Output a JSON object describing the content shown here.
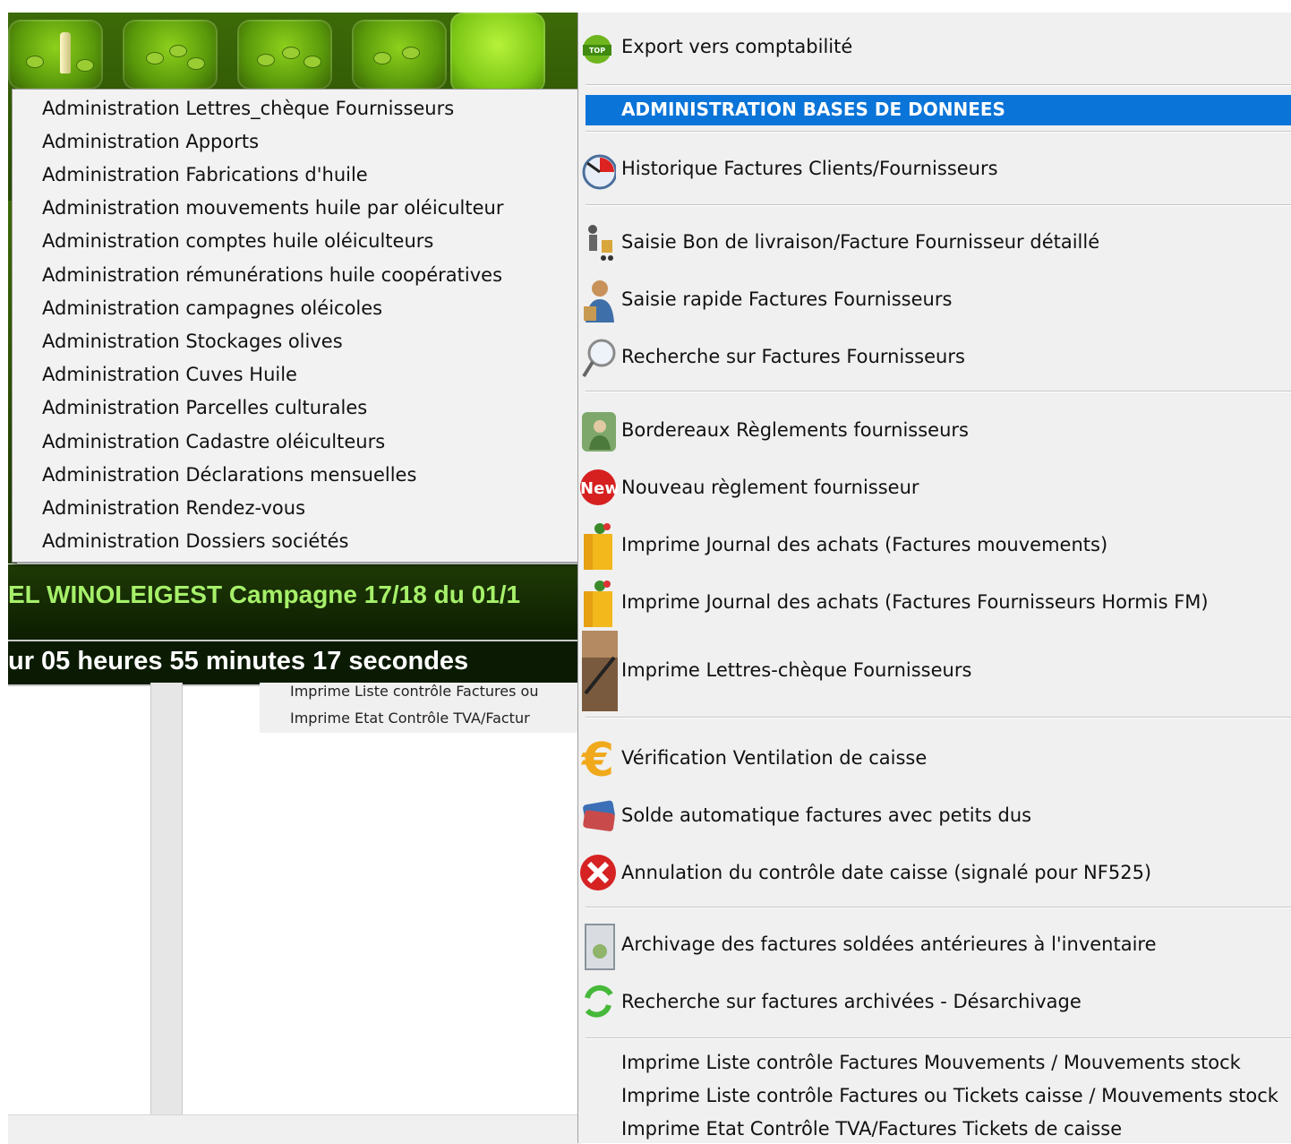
{
  "background_window": {
    "campagne_text": "EL WINOLEIGEST Campagne 17/18 du 01/1",
    "timer_text": "ur 05 heures 55 minutes 17 secondes",
    "partial_items": [
      "Imprime Liste contrôle Factures ou",
      "Imprime Etat Contrôle TVA/Factur"
    ]
  },
  "submenu": {
    "items": [
      "Administration Lettres_chèque Fournisseurs",
      "Administration Apports",
      "Administration Fabrications d'huile",
      "Administration mouvements huile par oléiculteur",
      "Administration comptes huile oléiculteurs",
      "Administration rémunérations huile coopératives",
      "Administration campagnes oléicoles",
      "Administration Stockages olives",
      "Administration Cuves Huile",
      "Administration Parcelles culturales",
      "Administration Cadastre oléiculteurs",
      "Administration Déclarations mensuelles",
      "Administration Rendez-vous",
      "Administration Dossiers sociétés"
    ]
  },
  "main_menu": {
    "export": {
      "label": "Export vers comptabilité",
      "icon": "top-vente-badge-icon",
      "badge": "TOP VENTE"
    },
    "highlighted": {
      "label": "ADMINISTRATION BASES DE DONNEES"
    },
    "historique": {
      "label": "Historique Factures Clients/Fournisseurs",
      "icon": "clock-icon"
    },
    "saisie_bl": {
      "label": "Saisie Bon de livraison/Facture Fournisseur détaillé",
      "icon": "delivery-cart-icon"
    },
    "saisie_rapide": {
      "label": "Saisie rapide Factures Fournisseurs",
      "icon": "user-box-icon"
    },
    "recherche": {
      "label": "Recherche sur Factures Fournisseurs",
      "icon": "magnifier-icon"
    },
    "bordereaux": {
      "label": "Bordereaux Règlements fournisseurs",
      "icon": "payment-person-icon"
    },
    "nouveau_reglement": {
      "label": "Nouveau règlement fournisseur",
      "icon": "new-badge-icon",
      "badge": "New"
    },
    "journal_mvt": {
      "label": "Imprime Journal des achats (Factures mouvements)",
      "icon": "shopping-bag-icon"
    },
    "journal_hors_fm": {
      "label": "Imprime Journal des achats (Factures Fournisseurs Hormis FM)",
      "icon": "shopping-bag-icon"
    },
    "lettres_cheque": {
      "label": "Imprime Lettres-chèque Fournisseurs",
      "icon": "pen-signing-icon"
    },
    "verification": {
      "label": "Vérification Ventilation de caisse",
      "icon": "euro-icon"
    },
    "solde": {
      "label": "Solde automatique factures avec petits dus",
      "icon": "credit-cards-icon"
    },
    "annulation": {
      "label": "Annulation du contrôle date caisse (signalé pour NF525)",
      "icon": "red-cross-icon"
    },
    "archivage": {
      "label": "Archivage des factures soldées antérieures à l'inventaire",
      "icon": "archive-icon"
    },
    "recherche_archivees": {
      "label": "Recherche sur factures archivées - Désarchivage",
      "icon": "green-refresh-icon"
    },
    "liste_mvt_stock": {
      "label": "Imprime Liste contrôle Factures Mouvements / Mouvements stock"
    },
    "liste_tickets_stock": {
      "label": "Imprime Liste contrôle Factures ou Tickets caisse / Mouvements stock"
    },
    "etat_tva": {
      "label": "Imprime Etat Contrôle TVA/Factures Tickets de caisse"
    }
  },
  "colors": {
    "highlight": "#0a74d8",
    "banner_green": "#3d6a08",
    "campagne_text": "#a6f06a",
    "menu_bg": "#f0f0f0"
  }
}
